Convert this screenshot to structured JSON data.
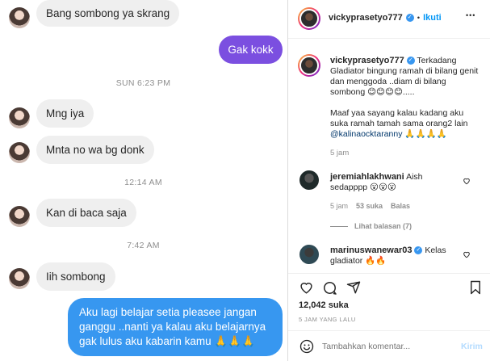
{
  "chat": {
    "messages": [
      {
        "type": "in",
        "text": "Bang sombong ya skrang"
      },
      {
        "type": "out",
        "text": "Gak kokk"
      },
      {
        "type": "time",
        "text": "SUN 6:23 PM"
      },
      {
        "type": "in",
        "text": "Mng iya"
      },
      {
        "type": "in",
        "text": "Mnta no wa bg donk"
      },
      {
        "type": "time",
        "text": "12:14 AM"
      },
      {
        "type": "in",
        "text": "Kan di baca saja"
      },
      {
        "type": "time",
        "text": "7:42 AM"
      },
      {
        "type": "in",
        "text": "Iih sombong"
      },
      {
        "type": "out",
        "text": "Aku lagi belajar setia pleasee jangan ganggu ..nanti ya kalau aku belajarnya gak lulus aku kabarin kamu 🙏🙏🙏"
      }
    ]
  },
  "post": {
    "header": {
      "username": "vickyprasetyo777",
      "separator": "•",
      "follow_label": "Ikuti",
      "more": "•••"
    },
    "caption": {
      "username": "vickyprasetyo777",
      "text": "Terkadang Gladiator bingung ramah di bilang genit dan menggoda ..diam di bilang sombong 😊😊😊😊.....",
      "text2": "Maaf yaa sayang kalau kadang aku suka ramah tamah sama orang2 lain",
      "mention": "@kalinaocktaranny",
      "emoji": "🙏🙏🙏🙏",
      "time": "5 jam"
    },
    "comments": [
      {
        "username": "jeremiahlakhwani",
        "text": "Aish sedapppp 😮😮😮",
        "time": "5 jam",
        "likes": "53 suka",
        "reply": "Balas",
        "view_replies": "Lihat balasan (7)"
      },
      {
        "username": "marinuswanewar03",
        "text": "Kelas gladiator 🔥🔥"
      }
    ],
    "likes": "12,042 suka",
    "date": "5 JAM YANG LALU",
    "comment_placeholder": "Tambahkan komentar...",
    "post_label": "Kirim"
  },
  "colors": {
    "accent": "#3797f0",
    "purple_bubble": "#7b4fe0",
    "incoming_bubble": "#efefef"
  }
}
